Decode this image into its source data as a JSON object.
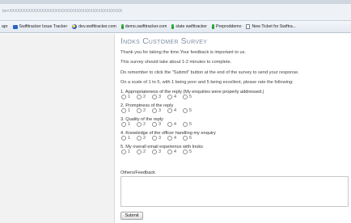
{
  "browser": {
    "url": "bx=XXXXXXXXXXXXXXXXXXXXXXXXXXXXXXXXXXXXXXXXXX",
    "bookmarks": [
      {
        "label": "apr",
        "icon": "none"
      },
      {
        "label": "Swifttracker Issue Tracker",
        "icon": "blue-folder-icon"
      },
      {
        "label": "dev.swifttracker.com",
        "icon": "swift-logo-icon"
      },
      {
        "label": "demo.swifttracker.com",
        "icon": "green-tick-icon"
      },
      {
        "label": "slate swifttracker",
        "icon": "green-tick-icon"
      },
      {
        "label": "Preproddemo",
        "icon": "green-tick-icon"
      },
      {
        "label": "New Ticket for Swiftra...",
        "icon": "page-icon"
      }
    ]
  },
  "survey": {
    "title": "Inoks Customer Survey",
    "intro": [
      "Thank you for taking the time.Your feedback is important to us.",
      "This survey should take about 1-2 minutes to complete.",
      "Do remember to click the \"Submit\" button at the end of the survey to send your response.",
      "On a scale of 1 to 5, with 1 being poor and 5 being excellent, please rate the following:"
    ],
    "scale": [
      "1",
      "2",
      "3",
      "4",
      "5"
    ],
    "questions": [
      "1. Appropriateness of the reply (My enquiries were properly addressed.)",
      "2. Promptness of the reply",
      "3. Quality of the reply",
      "4. Knowledge of the officer handling my enquiry",
      "5. My overall email experience with Inoks"
    ],
    "feedback_label": "Others/Feedback",
    "submit_label": "Submit"
  }
}
